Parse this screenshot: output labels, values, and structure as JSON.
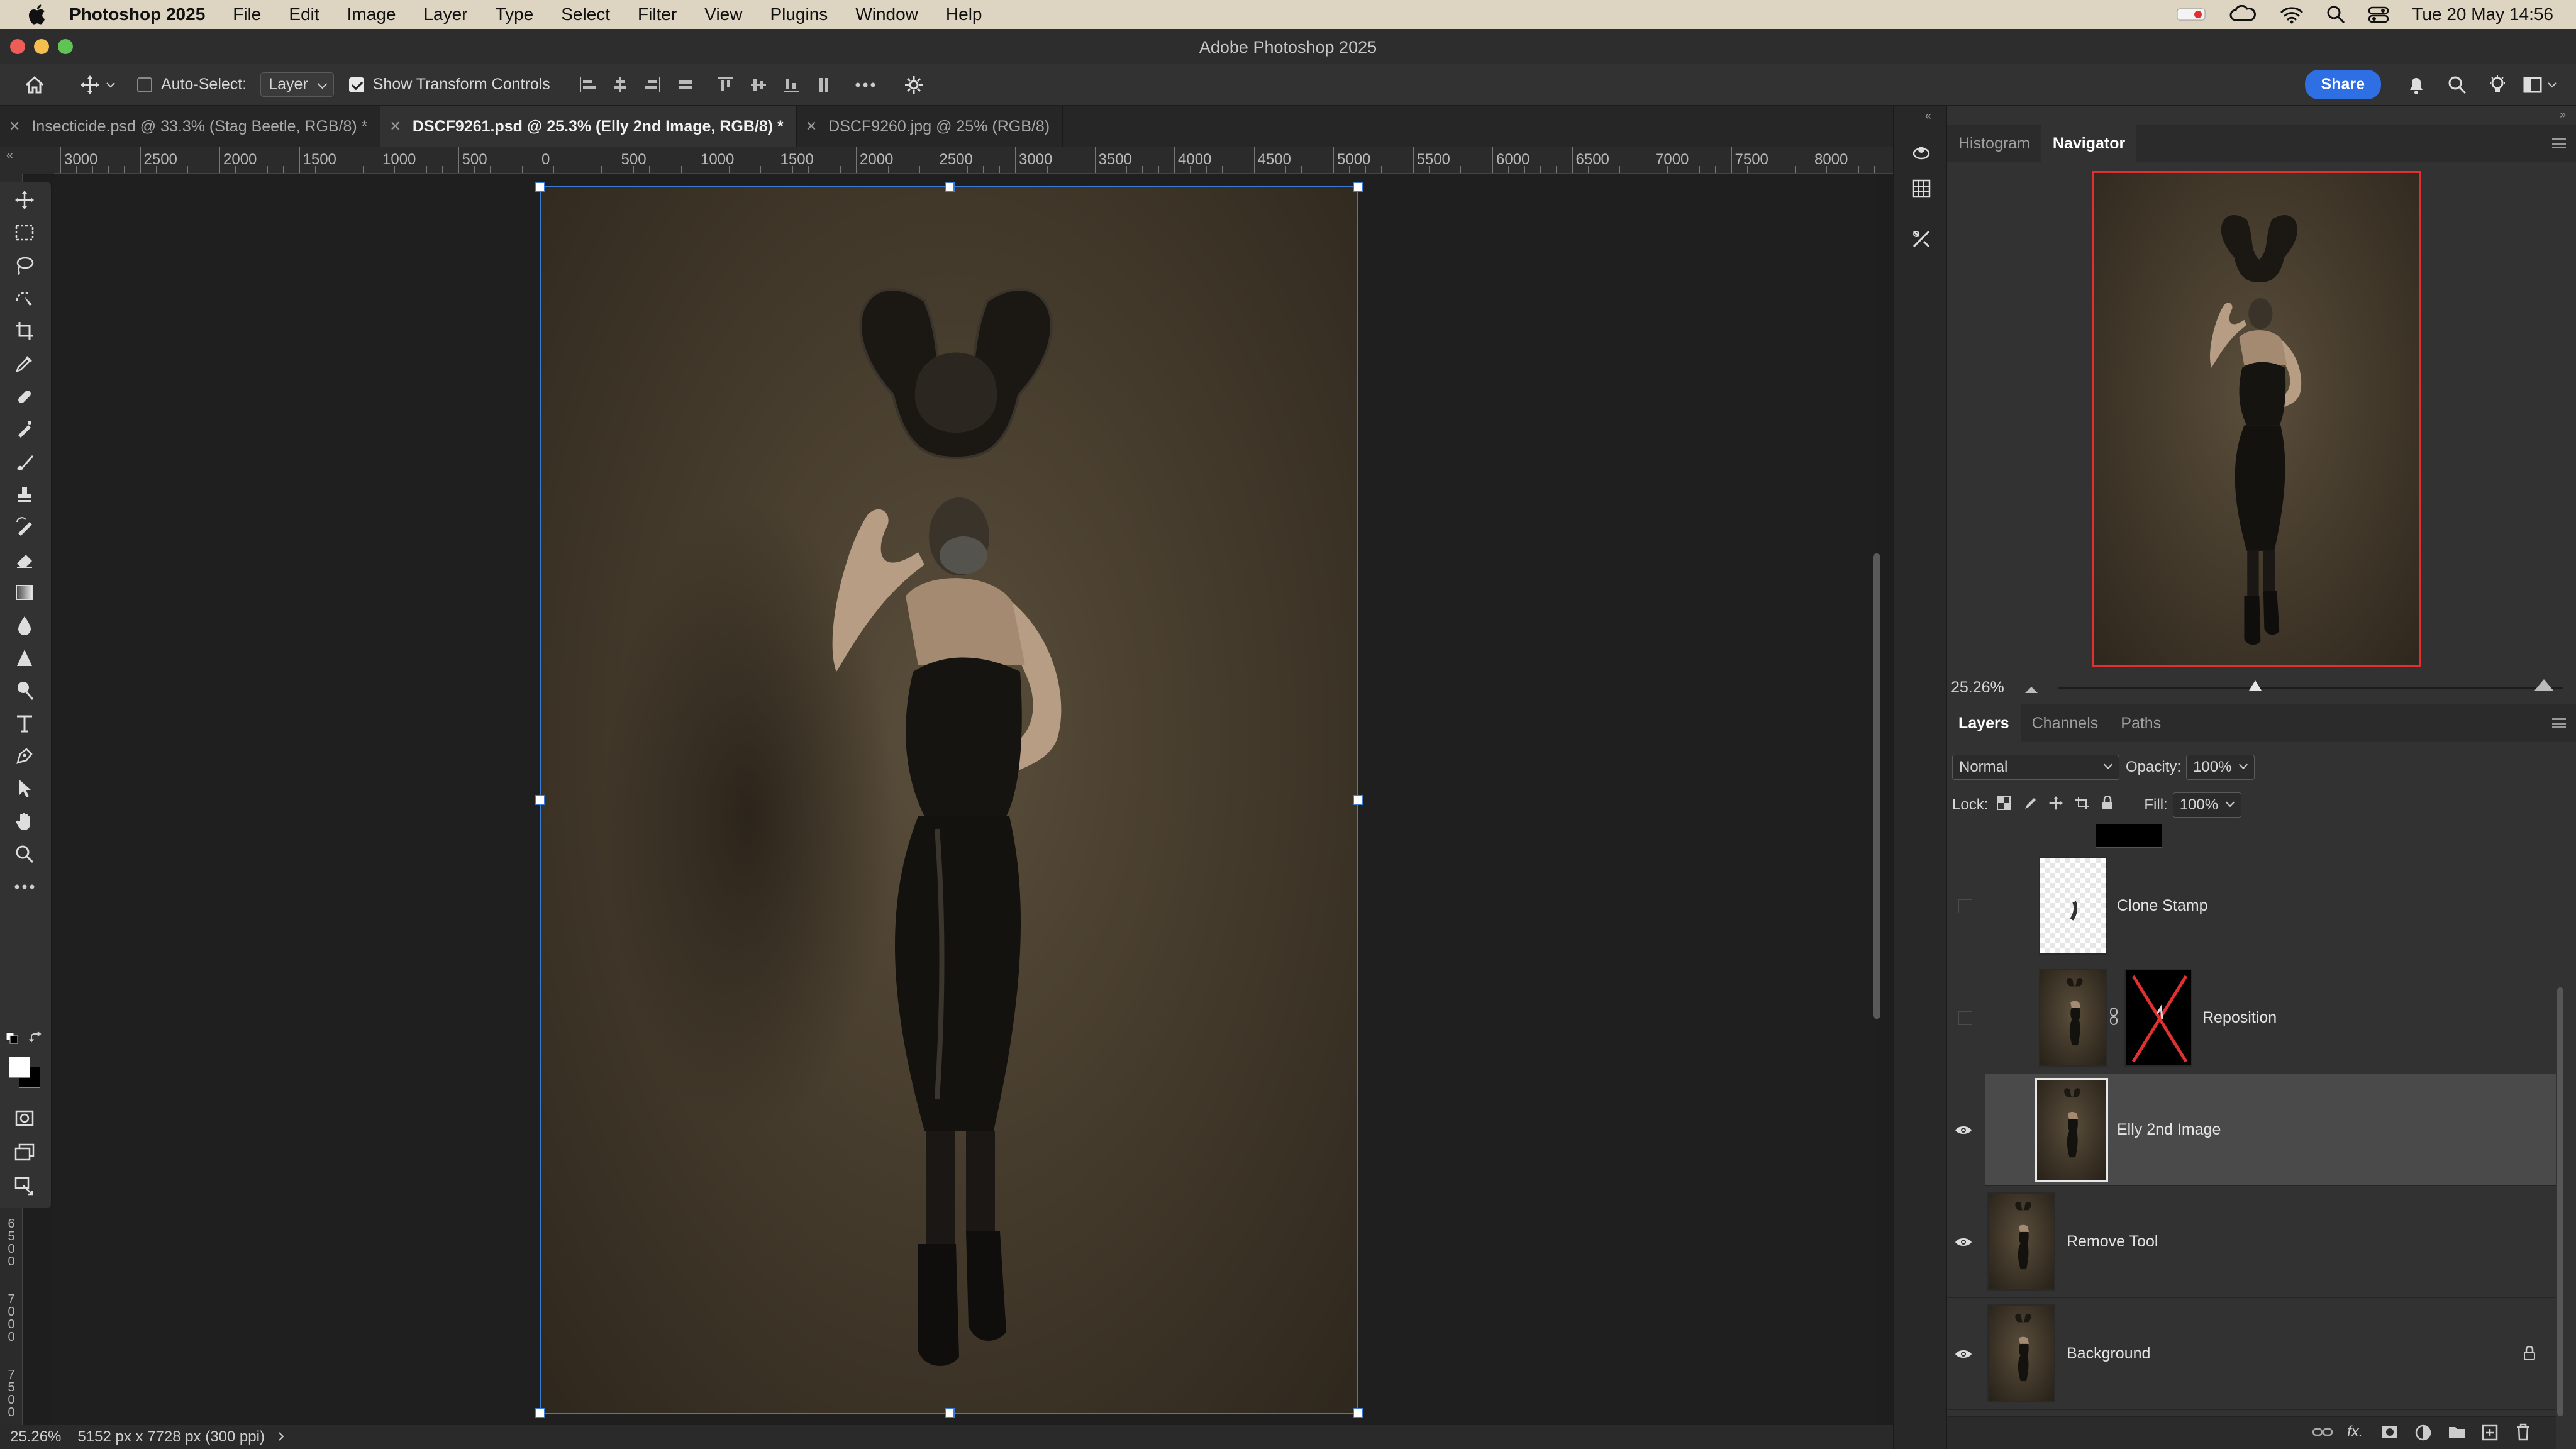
{
  "menubar": {
    "app_name": "Photoshop 2025",
    "items": [
      "File",
      "Edit",
      "Image",
      "Layer",
      "Type",
      "Select",
      "Filter",
      "View",
      "Plugins",
      "Window",
      "Help"
    ],
    "datetime": "Tue 20 May  14:56"
  },
  "window": {
    "title": "Adobe Photoshop 2025"
  },
  "options": {
    "auto_select_label": "Auto-Select:",
    "auto_select_checked": false,
    "auto_select_target": "Layer",
    "show_transform_label": "Show Transform Controls",
    "show_transform_checked": true,
    "share_label": "Share"
  },
  "doc_tabs": [
    {
      "label": "Insecticide.psd @ 33.3% (Stag Beetle, RGB/8) *",
      "active": false
    },
    {
      "label": "DSCF9261.psd @ 25.3% (Elly 2nd Image, RGB/8) *",
      "active": true
    },
    {
      "label": "DSCF9260.jpg @ 25% (RGB/8)",
      "active": false
    }
  ],
  "ruler": {
    "labels": [
      "3000",
      "2500",
      "2000",
      "1500",
      "1000",
      "500",
      "0",
      "500",
      "1000",
      "1500",
      "2000",
      "2500",
      "3000",
      "3500",
      "4000",
      "4500",
      "5000",
      "5500",
      "6000",
      "6500",
      "7000",
      "7500",
      "8000"
    ],
    "vertical_labels": [
      "6500",
      "7000",
      "7500"
    ]
  },
  "status": {
    "zoom": "25.26%",
    "doc_info": "5152 px x 7728 px (300 ppi)"
  },
  "navigator": {
    "tabs": [
      "Histogram",
      "Navigator"
    ],
    "active_tab": "Navigator",
    "zoom": "25.26%",
    "zoom_slider_fraction": 0.39
  },
  "layers_panel": {
    "tabs": [
      "Layers",
      "Channels",
      "Paths"
    ],
    "active_tab": "Layers",
    "blend_mode": "Normal",
    "opacity_label": "Opacity:",
    "opacity": "100%",
    "lock_label": "Lock:",
    "fill_label": "Fill:",
    "fill": "100%",
    "layers": [
      {
        "name": "Clone Stamp",
        "visible": false,
        "selected": false,
        "mask": false,
        "locked": false
      },
      {
        "name": "Reposition",
        "visible": false,
        "selected": false,
        "mask": true,
        "locked": false
      },
      {
        "name": "Elly 2nd Image",
        "visible": true,
        "selected": true,
        "mask": false,
        "locked": false
      },
      {
        "name": "Remove Tool",
        "visible": true,
        "selected": false,
        "mask": false,
        "locked": false
      },
      {
        "name": "Background",
        "visible": true,
        "selected": false,
        "mask": false,
        "locked": true
      }
    ]
  },
  "colors": {
    "selection_blue": "#3b7bd8",
    "share_blue": "#2f6fe4",
    "navigator_frame": "#e0302f",
    "menubar_bg": "#ddd4c1"
  }
}
